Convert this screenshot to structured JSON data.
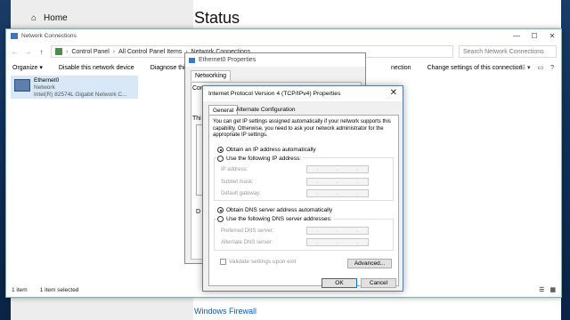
{
  "settings": {
    "home_label": "Home",
    "status_title": "Status",
    "windows_firewall": "Windows Firewall"
  },
  "nc": {
    "title": "Network Connections",
    "breadcrumb": [
      "Control Panel",
      "All Control Panel Items",
      "Network Connections"
    ],
    "search_placeholder": "Search Network Connections",
    "commands": {
      "organize": "Organize ▾",
      "disable": "Disable this network device",
      "diagnose": "Diagnose this c",
      "connection": "nection",
      "change_settings": "Change settings of this connection"
    },
    "item": {
      "name": "Ethernet0",
      "type": "Network",
      "adapter": "Intel(R) 82574L Gigabit Network C..."
    },
    "status": {
      "count": "1 item",
      "selected": "1 item selected"
    }
  },
  "eth_props": {
    "title": "Ethernet0 Properties",
    "tab": "Networking",
    "connect_label": "Connect",
    "this_label": "Thi",
    "d_label": "D"
  },
  "tcp": {
    "title": "Internet Protocol Version 4 (TCP/IPv4) Properties",
    "tabs": {
      "general": "General",
      "alternate": "Alternate Configuration"
    },
    "description": "You can get IP settings assigned automatically if your network supports this capability. Otherwise, you need to ask your network administrator for the appropriate IP settings.",
    "radio_auto_ip": "Obtain an IP address automatically",
    "radio_manual_ip": "Use the following IP address:",
    "field_ip": "IP address:",
    "field_subnet": "Subnet mask:",
    "field_gateway": "Default gateway:",
    "radio_auto_dns": "Obtain DNS server address automatically",
    "radio_manual_dns": "Use the following DNS server addresses:",
    "field_pref_dns": "Preferred DNS server:",
    "field_alt_dns": "Alternate DNS server:",
    "validate": "Validate settings upon exit",
    "advanced": "Advanced...",
    "ok": "OK",
    "cancel": "Cancel"
  }
}
